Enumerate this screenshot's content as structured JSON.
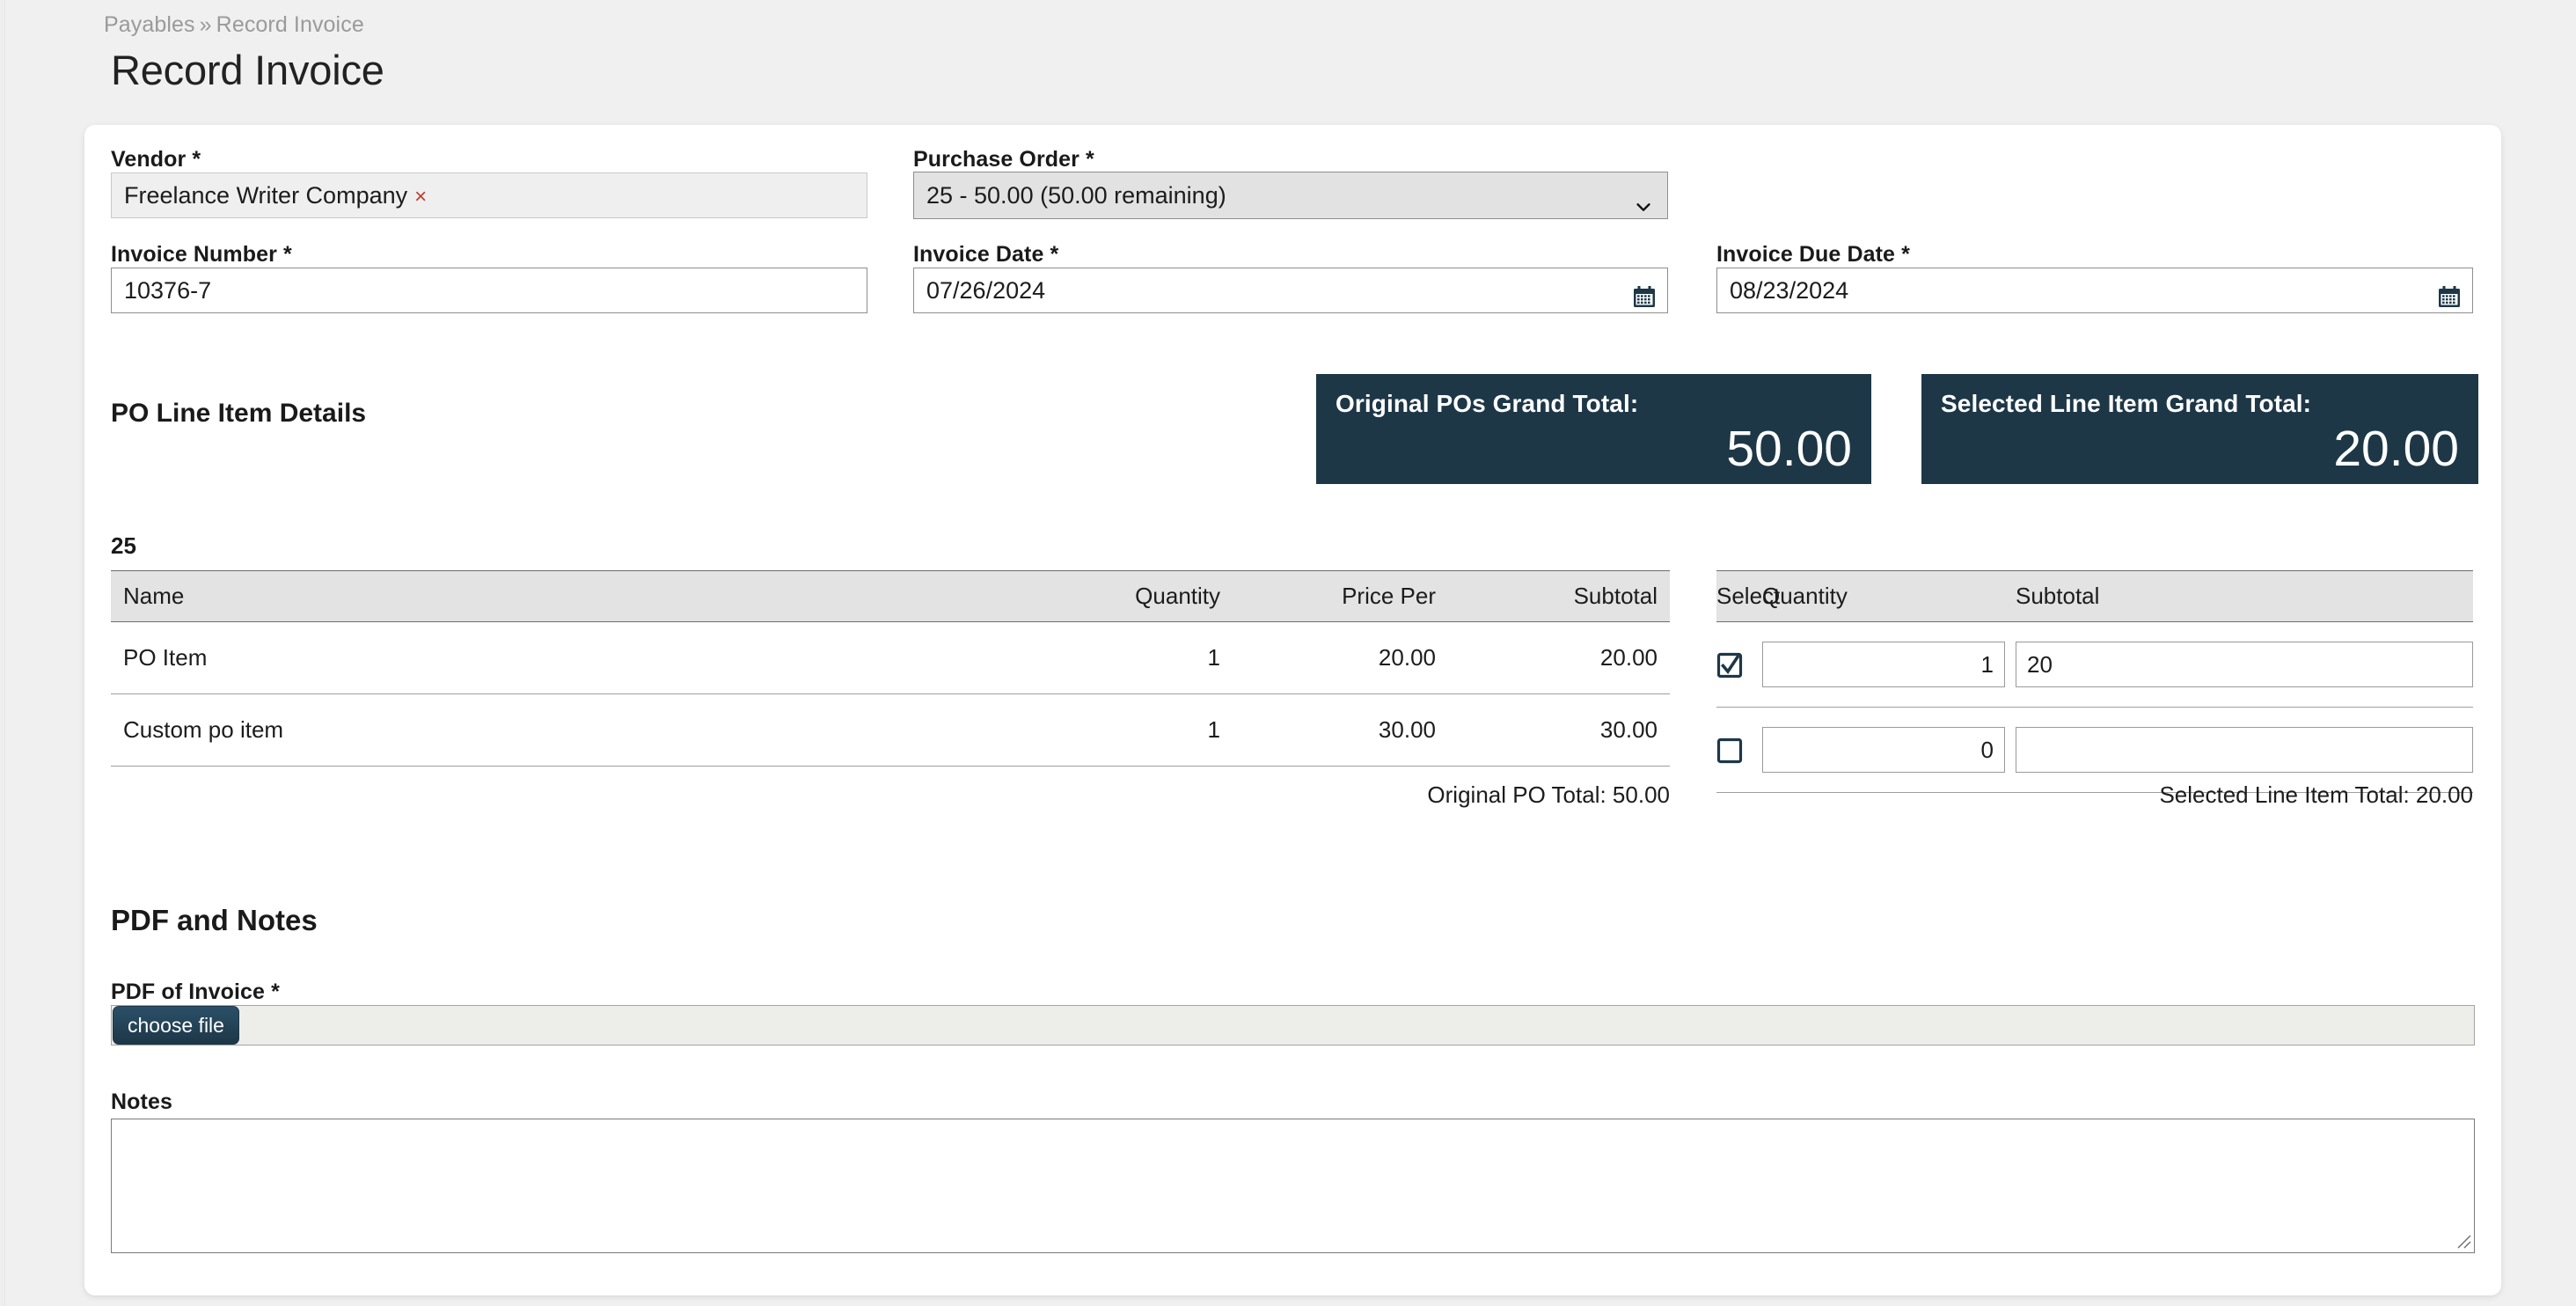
{
  "breadcrumb": {
    "parent": "Payables",
    "separator": "»",
    "current": "Record Invoice"
  },
  "page_title": "Record Invoice",
  "colors": {
    "page_background": "#f0f0f0",
    "card_background": "#ffffff",
    "panel_navy": "#1d3747",
    "accent_button": "#1d3747",
    "remove_x_red": "#c0392b",
    "table_header_gray": "#e3e3e3",
    "disabled_field_gray": "#efefef",
    "select_gray": "#e2e2e2",
    "file_row_gray": "#edeeea"
  },
  "form": {
    "vendor": {
      "label": "Vendor",
      "required_mark": "*",
      "value": "Freelance Writer Company",
      "remove_glyph": "×"
    },
    "purchase_order": {
      "label": "Purchase Order",
      "required_mark": "*",
      "selected": "25 - 50.00 (50.00 remaining)"
    },
    "invoice_number": {
      "label": "Invoice Number",
      "required_mark": "*",
      "value": "10376-7",
      "placeholder": ""
    },
    "invoice_date": {
      "label": "Invoice Date",
      "required_mark": "*",
      "value": "07/26/2024",
      "placeholder": ""
    },
    "invoice_due_date": {
      "label": "Invoice Due Date",
      "required_mark": "*",
      "value": "08/23/2024",
      "placeholder": ""
    }
  },
  "po_line_item_details": {
    "section_title": "PO Line Item Details",
    "po_group_number": "25",
    "totals_panels": [
      {
        "label": "Original POs Grand Total:",
        "value": "50.00"
      },
      {
        "label": "Selected Line Item Grand Total:",
        "value": "20.00"
      }
    ],
    "original_table": {
      "headers": [
        "Name",
        "Quantity",
        "Price Per",
        "Subtotal"
      ],
      "rows": [
        {
          "name": "PO Item",
          "quantity": "1",
          "price_per": "20.00",
          "subtotal": "20.00"
        },
        {
          "name": "Custom po item",
          "quantity": "1",
          "price_per": "30.00",
          "subtotal": "30.00"
        }
      ],
      "total_line": "Original PO Total: 50.00"
    },
    "selected_table": {
      "headers": [
        "Select",
        "Quantity",
        "Subtotal"
      ],
      "rows": [
        {
          "selected": true,
          "quantity": "1",
          "subtotal": "20"
        },
        {
          "selected": false,
          "quantity": "0",
          "subtotal": ""
        }
      ],
      "total_line": "Selected Line Item Total: 20.00"
    }
  },
  "pdf_and_notes": {
    "section_title": "PDF and Notes",
    "pdf_field": {
      "label": "PDF of Invoice",
      "required_mark": "*",
      "button_label": "choose file",
      "file_name": ""
    },
    "notes_field": {
      "label": "Notes",
      "value": "",
      "placeholder": ""
    }
  }
}
